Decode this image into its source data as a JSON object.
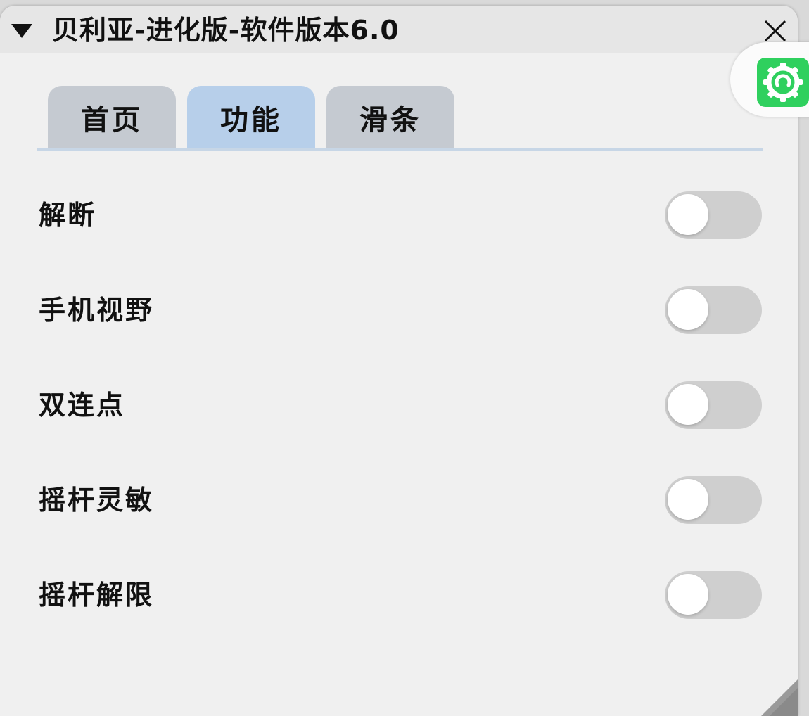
{
  "window": {
    "title": "贝利亚-进化版-软件版本6.0"
  },
  "tabs": [
    {
      "label": "首页",
      "active": false
    },
    {
      "label": "功能",
      "active": true
    },
    {
      "label": "滑条",
      "active": false
    }
  ],
  "features": [
    {
      "label": "解断",
      "enabled": false
    },
    {
      "label": "手机视野",
      "enabled": false
    },
    {
      "label": "双连点",
      "enabled": false
    },
    {
      "label": "摇杆灵敏",
      "enabled": false
    },
    {
      "label": "摇杆解限",
      "enabled": false
    }
  ],
  "icons": {
    "collapse": "triangle-down-icon",
    "close": "close-icon",
    "settings": "gear-icon",
    "resize": "resize-corner-icon"
  },
  "colors": {
    "active_tab": "#b7cfea",
    "inactive_tab": "#c5cad1",
    "toggle_off": "#cfcfcf",
    "settings_green": "#2fd05e"
  }
}
